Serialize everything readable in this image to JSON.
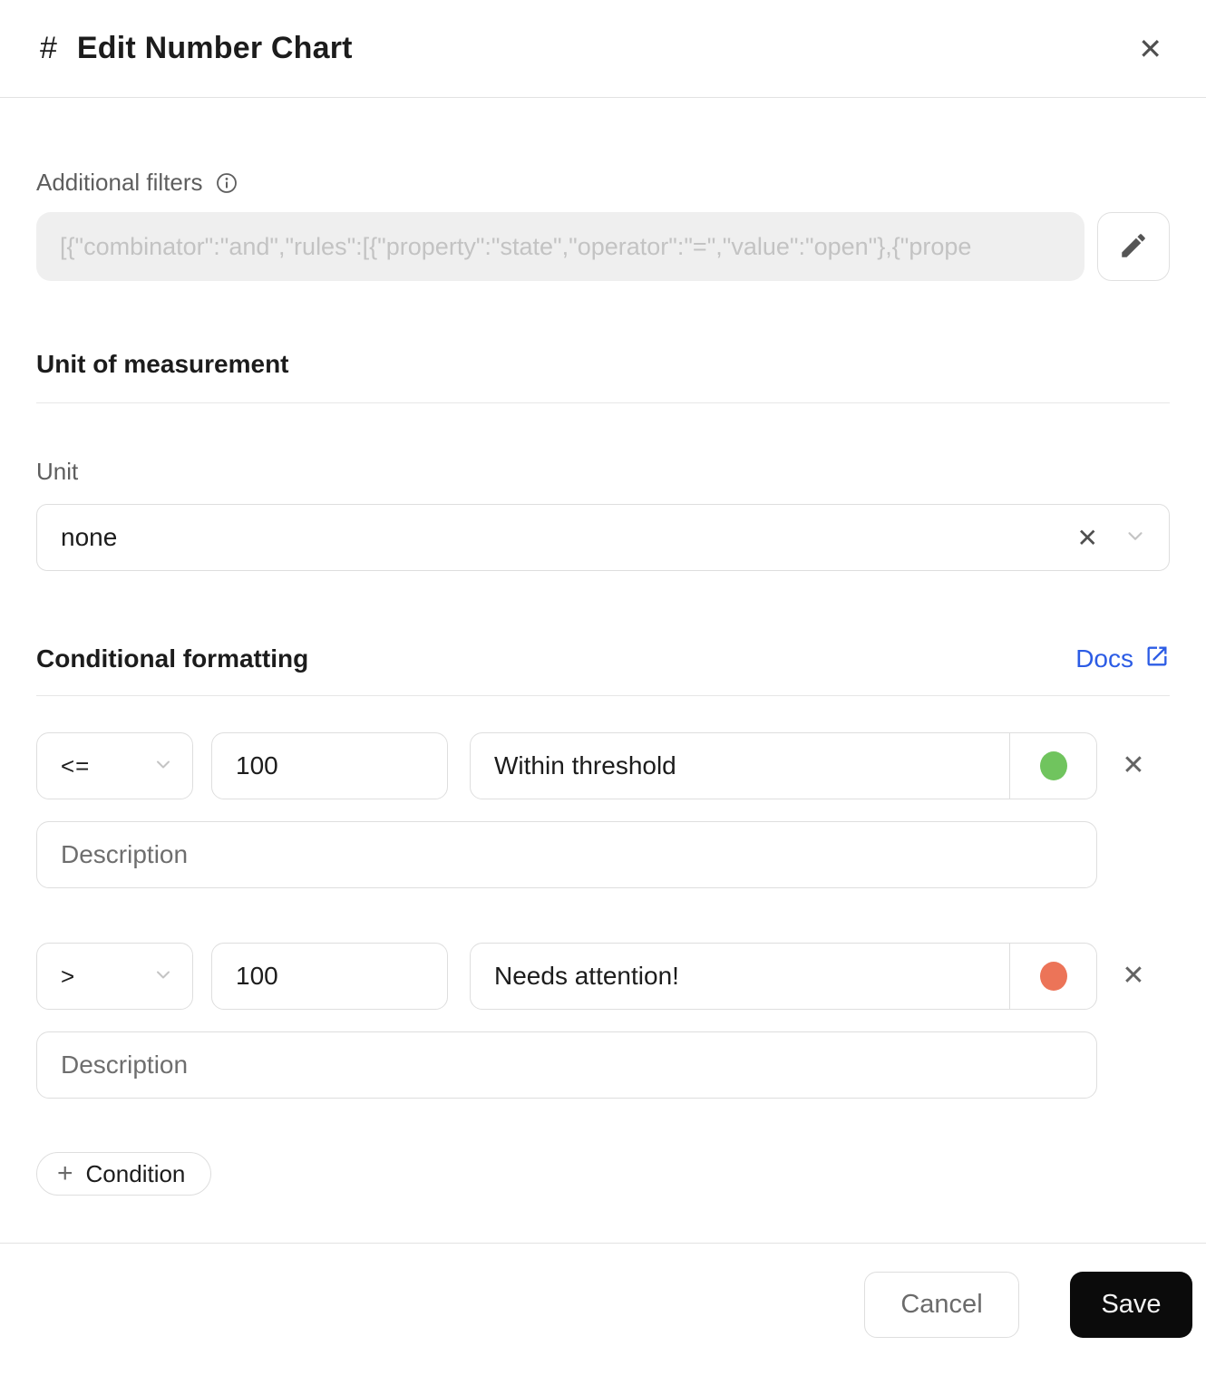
{
  "dialog": {
    "title": "Edit Number Chart",
    "title_icon": "#",
    "close_glyph": "✕"
  },
  "filters": {
    "label": "Additional filters",
    "value": "[{\"combinator\":\"and\",\"rules\":[{\"property\":\"state\",\"operator\":\"=\",\"value\":\"open\"},{\"prope",
    "edit_icon": "pencil-icon"
  },
  "unit_section": {
    "heading": "Unit of measurement",
    "unit_label": "Unit",
    "unit_value": "none",
    "clear_glyph": "✕"
  },
  "conditional": {
    "heading": "Conditional formatting",
    "docs_label": "Docs",
    "docs_color": "#2c5ce5",
    "add_button_label": "Condition",
    "add_button_plus": "+",
    "remove_glyph": "✕",
    "conditions": [
      {
        "operator": "<=",
        "value": "100",
        "label": "Within threshold",
        "color": "#70c45e",
        "description_placeholder": "Description"
      },
      {
        "operator": ">",
        "value": "100",
        "label": "Needs attention!",
        "color": "#ec7458",
        "description_placeholder": "Description"
      }
    ]
  },
  "footer": {
    "cancel_label": "Cancel",
    "save_label": "Save",
    "save_bg": "#0b0b0b"
  }
}
